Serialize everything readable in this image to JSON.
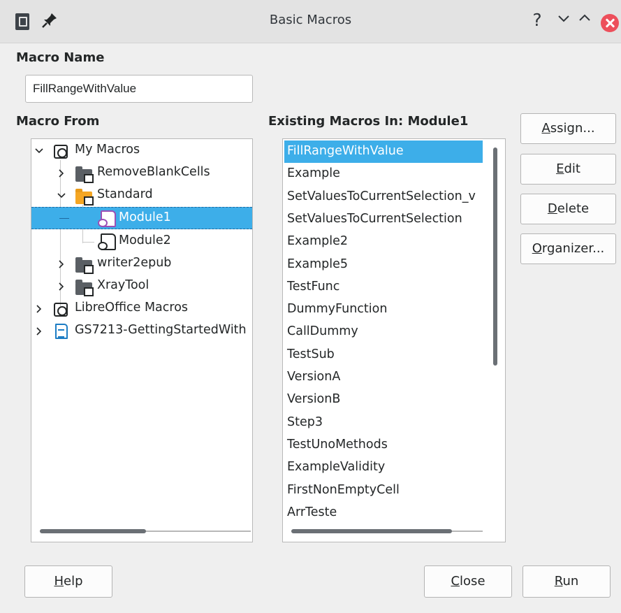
{
  "window": {
    "title": "Basic Macros",
    "help_glyph": "?",
    "minimize_glyph": "⌄",
    "maximize_glyph": "⌃"
  },
  "macro_name": {
    "heading": "Macro Name",
    "value": "FillRangeWithValue"
  },
  "macro_from": {
    "heading": "Macro From",
    "tree": [
      {
        "label": "My Macros",
        "icon": "macro-library-icon",
        "expanded": true
      },
      {
        "label": "RemoveBlankCells",
        "icon": "folder-icon",
        "expanded": false
      },
      {
        "label": "Standard",
        "icon": "folder-open-icon",
        "expanded": true
      },
      {
        "label": "Module1",
        "icon": "module-icon",
        "selected": true
      },
      {
        "label": "Module2",
        "icon": "module-icon"
      },
      {
        "label": "writer2epub",
        "icon": "folder-icon",
        "expanded": false
      },
      {
        "label": "XrayTool",
        "icon": "folder-icon",
        "expanded": false
      },
      {
        "label": "LibreOffice Macros",
        "icon": "macro-library-icon",
        "expanded": false
      },
      {
        "label": "GS7213-GettingStartedWith",
        "icon": "document-icon",
        "expanded": false
      }
    ]
  },
  "existing_macros": {
    "heading": "Existing Macros In: Module1",
    "items": [
      "FillRangeWithValue",
      "Example",
      "SetValuesToCurrentSelection_v",
      "SetValuesToCurrentSelection",
      "Example2",
      "Example5",
      "TestFunc",
      "DummyFunction",
      "CallDummy",
      "TestSub",
      "VersionA",
      "VersionB",
      "Step3",
      "TestUnoMethods",
      "ExampleValidity",
      "FirstNonEmptyCell",
      "ArrTeste"
    ],
    "selected_index": 0
  },
  "side_buttons": {
    "assign": {
      "mnemonic": "A",
      "rest": "ssign..."
    },
    "edit": {
      "mnemonic": "E",
      "rest": "dit"
    },
    "delete": {
      "mnemonic": "D",
      "rest": "elete"
    },
    "organizer": {
      "mnemonic": "O",
      "rest": "rganizer..."
    }
  },
  "footer_buttons": {
    "help": {
      "mnemonic": "H",
      "rest": "elp"
    },
    "close": {
      "mnemonic": "C",
      "rest": "lose"
    },
    "run": {
      "mnemonic": "R",
      "rest": "un"
    }
  },
  "colors": {
    "selection": "#3daee9",
    "close_button": "#ed4f5b",
    "window_bg": "#efefef"
  }
}
